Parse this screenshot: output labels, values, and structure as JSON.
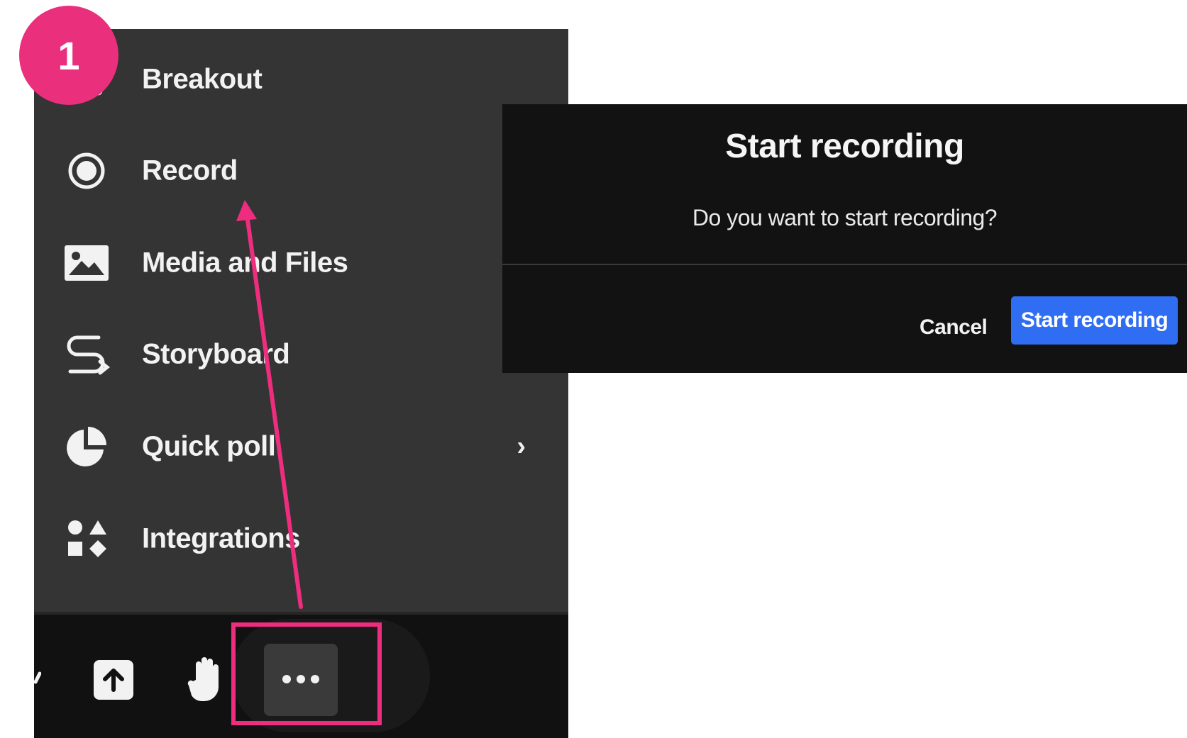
{
  "badge": {
    "number": "1",
    "color": "#ea2f7d"
  },
  "menu": {
    "items": [
      {
        "label": "Breakout",
        "icon": "breakout-icon"
      },
      {
        "label": "Record",
        "icon": "record-icon"
      },
      {
        "label": "Media and Files",
        "icon": "image-icon"
      },
      {
        "label": "Storyboard",
        "icon": "storyboard-icon"
      },
      {
        "label": "Quick poll",
        "icon": "pie-chart-icon",
        "has_submenu": true,
        "chevron": "›"
      },
      {
        "label": "Integrations",
        "icon": "shapes-icon"
      }
    ]
  },
  "toolbar": {
    "buttons": [
      {
        "icon": "share-upload-icon"
      },
      {
        "icon": "raise-hand-icon"
      },
      {
        "icon": "more-options-icon",
        "label": "•••"
      }
    ]
  },
  "dialog": {
    "title": "Start recording",
    "message": "Do you want to start recording?",
    "cancel_label": "Cancel",
    "confirm_label": "Start recording"
  },
  "colors": {
    "accent_pink": "#ee2d7f",
    "primary_blue": "#2f6df3",
    "menu_bg": "#343434",
    "dialog_bg": "#121212"
  }
}
